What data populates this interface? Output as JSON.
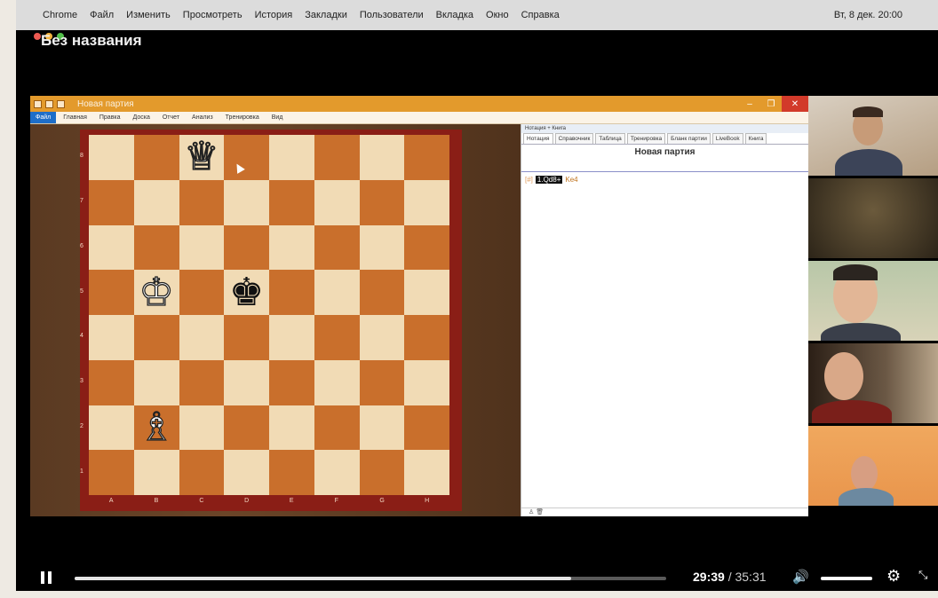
{
  "mac_menu": {
    "items": [
      "Chrome",
      "Файл",
      "Изменить",
      "Просмотреть",
      "История",
      "Закладки",
      "Пользователи",
      "Вкладка",
      "Окно",
      "Справка"
    ],
    "clock": "Вт, 8 дек. 20:00"
  },
  "video": {
    "title": "Без названия"
  },
  "app": {
    "window_title": "Новая партия",
    "ribbon": {
      "file_tab": "Файл",
      "items": [
        "Главная",
        "Правка",
        "Доска",
        "Отчет",
        "Анализ",
        "Тренировка",
        "Вид"
      ]
    },
    "board": {
      "files": [
        "A",
        "B",
        "C",
        "D",
        "E",
        "F",
        "G",
        "H"
      ],
      "ranks": [
        "8",
        "7",
        "6",
        "5",
        "4",
        "3",
        "2",
        "1"
      ],
      "pieces": [
        {
          "square": "c8",
          "glyph": "♕",
          "color": "white",
          "name": "white-queen"
        },
        {
          "square": "b5",
          "glyph": "♔",
          "color": "white",
          "name": "white-king"
        },
        {
          "square": "d5",
          "glyph": "♚",
          "color": "black",
          "name": "black-king"
        },
        {
          "square": "b2",
          "glyph": "♗",
          "color": "white",
          "name": "white-bishop"
        }
      ]
    },
    "notation": {
      "header": "Нотация + Книга",
      "tabs": [
        "Нотация",
        "Справочник",
        "Таблица",
        "Тренировка",
        "Бланк партии",
        "LiveBook",
        "Книга"
      ],
      "active_tab": "Нотация",
      "game_title": "Новая партия",
      "moves": {
        "marker": "[#]",
        "current": "1.Qd8+",
        "next": "Ke4"
      }
    }
  },
  "participants": [
    "participant-1",
    "participant-2",
    "participant-3",
    "participant-4",
    "participant-5"
  ],
  "player": {
    "progress": 0.839,
    "time_current": "29:39",
    "time_separator": " / ",
    "time_total": "35:31",
    "volume": 1.0
  },
  "colors": {
    "board_light": "#f1dbb5",
    "board_dark": "#c96f2c",
    "board_frame": "#8a1e16",
    "titlebar": "#e39a2c"
  }
}
